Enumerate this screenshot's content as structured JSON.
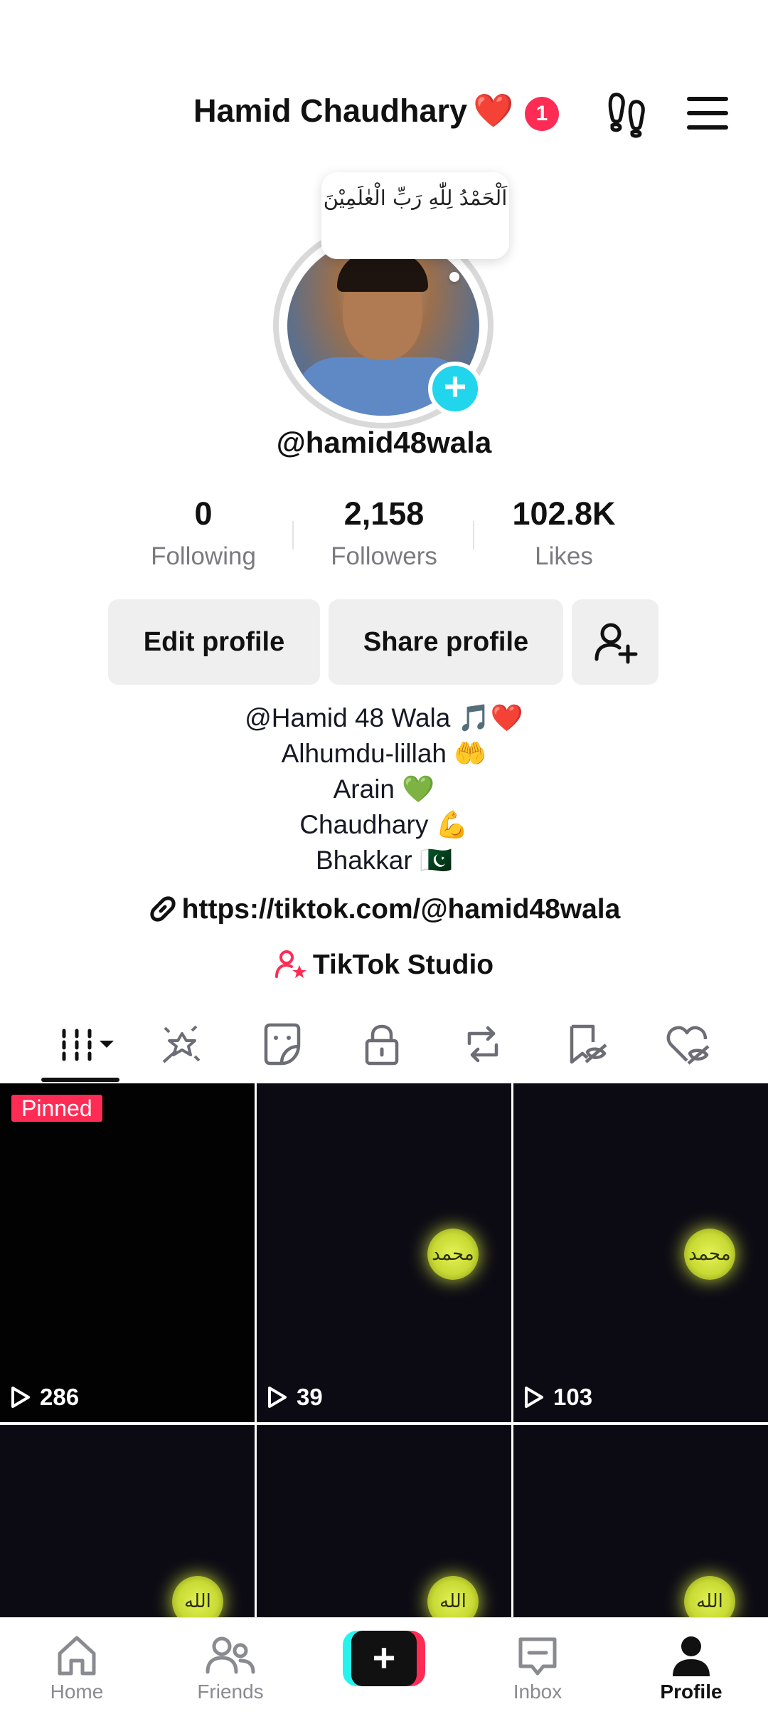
{
  "header": {
    "display_name": "Hamid Chaudhary",
    "heart_emoji": "❤️",
    "notification_count": "1"
  },
  "avatar": {
    "note_bubble": "اَلْحَمْدُ لِلّٰهِ رَبِّ الْعٰلَمِيْنَ"
  },
  "profile": {
    "username": "@hamid48wala"
  },
  "stats": {
    "following_count": "0",
    "following_label": "Following",
    "followers_count": "2,158",
    "followers_label": "Followers",
    "likes_count": "102.8K",
    "likes_label": "Likes"
  },
  "actions": {
    "edit_profile": "Edit profile",
    "share_profile": "Share profile"
  },
  "bio": {
    "lines": [
      "@Hamid 48 Wala 🎵❤️",
      "Alhumdu-lillah 🤲",
      "Arain 💚",
      "Chaudhary 💪",
      "Bhakkar 🇵🇰"
    ]
  },
  "link": {
    "url": "https://tiktok.com/@hamid48wala"
  },
  "studio": {
    "label": "TikTok Studio"
  },
  "tabs": {
    "icons": [
      "videos-grid-icon",
      "effects-icon",
      "stickers-icon",
      "private-lock-icon",
      "reposts-icon",
      "favorites-hidden-icon",
      "liked-hidden-icon"
    ]
  },
  "videos": [
    {
      "views": "286",
      "pinned": "Pinned"
    },
    {
      "views": "39"
    },
    {
      "views": "103"
    },
    {
      "views": ""
    },
    {
      "views": ""
    },
    {
      "views": ""
    }
  ],
  "emblem_text": {
    "muhammad": "محمد",
    "allah": "الله"
  },
  "nav": {
    "home": "Home",
    "friends": "Friends",
    "inbox": "Inbox",
    "profile": "Profile"
  },
  "colors": {
    "accent_pink": "#fe2c55",
    "accent_cyan": "#20d5ec"
  }
}
